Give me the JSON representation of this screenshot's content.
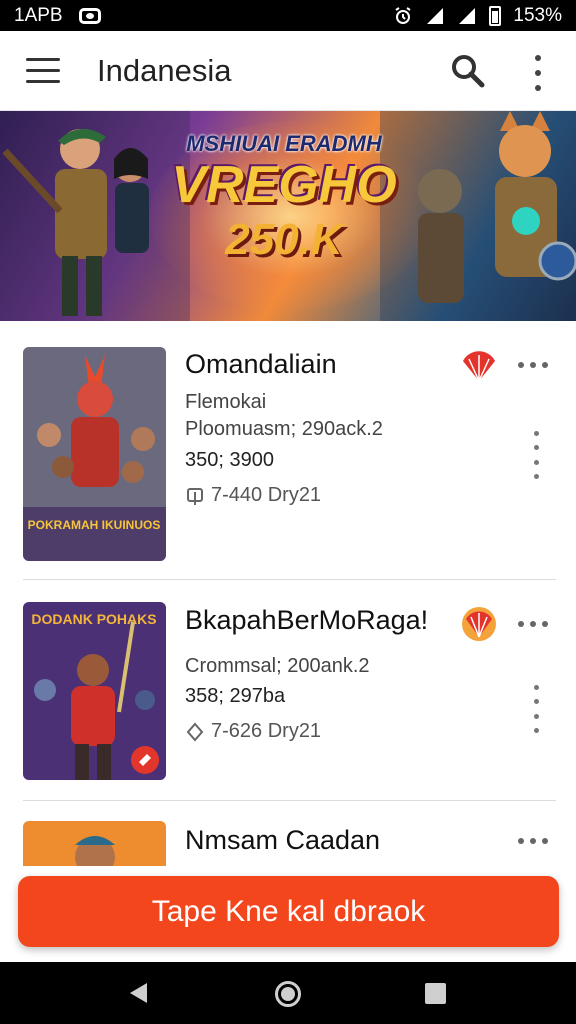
{
  "status": {
    "time": "1APB",
    "battery": "153%"
  },
  "app_bar": {
    "title": "Indanesia"
  },
  "banner": {
    "line1": "MSHIUAI ERADMH",
    "line2": "VREGHO",
    "line3": "250.K"
  },
  "items": [
    {
      "name": "Omandaliain",
      "subtitle": "Flemokai",
      "info": "Ploomuasm; 290ack.2",
      "price": "350; 3900",
      "meta": "7-440 Dry21",
      "thumb_text": "POKRAMAH IKUINUOS"
    },
    {
      "name": "BkapahBerMoRaga!",
      "info": "Crommsal; 200ank.2",
      "price": "358; 297ba",
      "meta": "7-626 Dry21",
      "thumb_text": "DODANK POHAKS"
    },
    {
      "name": "Nmsam Caadan"
    }
  ],
  "cta": {
    "label": "Tape Kne kal dbraok"
  },
  "colors": {
    "accent": "#f3461d",
    "status_bar": "#000000"
  }
}
